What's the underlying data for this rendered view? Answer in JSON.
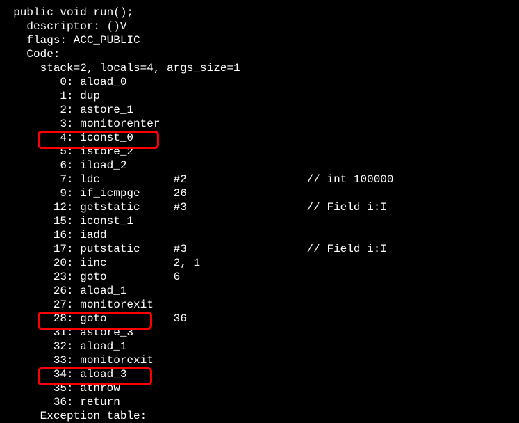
{
  "lines": [
    "  public void run();",
    "    descriptor: ()V",
    "    flags: ACC_PUBLIC",
    "    Code:",
    "      stack=2, locals=4, args_size=1",
    "         0: aload_0",
    "         1: dup",
    "         2: astore_1",
    "         3: monitorenter",
    "         4: iconst_0",
    "         5: istore_2",
    "         6: iload_2",
    "         7: ldc           #2                  // int 100000",
    "         9: if_icmpge     26",
    "        12: getstatic     #3                  // Field i:I",
    "        15: iconst_1",
    "        16: iadd",
    "        17: putstatic     #3                  // Field i:I",
    "        20: iinc          2, 1",
    "        23: goto          6",
    "        26: aload_1",
    "        27: monitorexit",
    "        28: goto          36",
    "        31: astore_3",
    "        32: aload_1",
    "        33: monitorexit",
    "        34: aload_3",
    "        35: athrow",
    "        36: return",
    "      Exception table:"
  ]
}
